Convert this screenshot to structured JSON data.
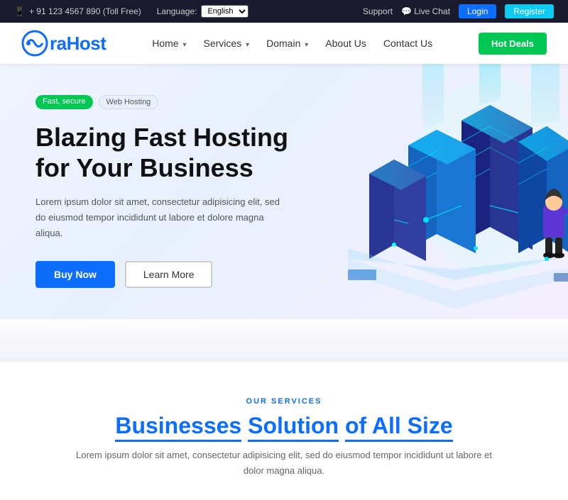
{
  "topbar": {
    "phone": "+ 91 123 4567 890 (Toll Free)",
    "language_label": "Language:",
    "language_value": "English",
    "support": "Support",
    "live_chat": "Live Chat",
    "login": "Login",
    "register": "Register"
  },
  "navbar": {
    "logo_text": "raHost",
    "nav_items": [
      {
        "label": "Home",
        "has_dropdown": true
      },
      {
        "label": "Services",
        "has_dropdown": true
      },
      {
        "label": "Domain",
        "has_dropdown": true
      },
      {
        "label": "About Us",
        "has_dropdown": false
      },
      {
        "label": "Contact Us",
        "has_dropdown": false
      }
    ],
    "hot_deals": "Hot Deals"
  },
  "hero": {
    "badge_fast": "Fast, secure",
    "badge_hosting": "Web Hosting",
    "title_line1": "Blazing Fast Hosting",
    "title_line2": "for Your Business",
    "description": "Lorem ipsum dolor sit amet, consectetur adipisicing elit, sed do eiusmod tempor incididunt ut labore et dolore magna aliqua.",
    "btn_buy": "Buy Now",
    "btn_learn": "Learn More"
  },
  "services": {
    "label": "OUR SERVICES",
    "title_plain": "Businesses",
    "title_highlight": "Solution",
    "title_end": "of All Size",
    "description": "Lorem ipsum dolor sit amet, consectetur adipisicing elit, sed do eiusmod tempor incididunt ut labore et dolor magna aliqua."
  },
  "colors": {
    "primary": "#0d6efd",
    "green": "#00c853",
    "cyan": "#0dcaf0"
  }
}
